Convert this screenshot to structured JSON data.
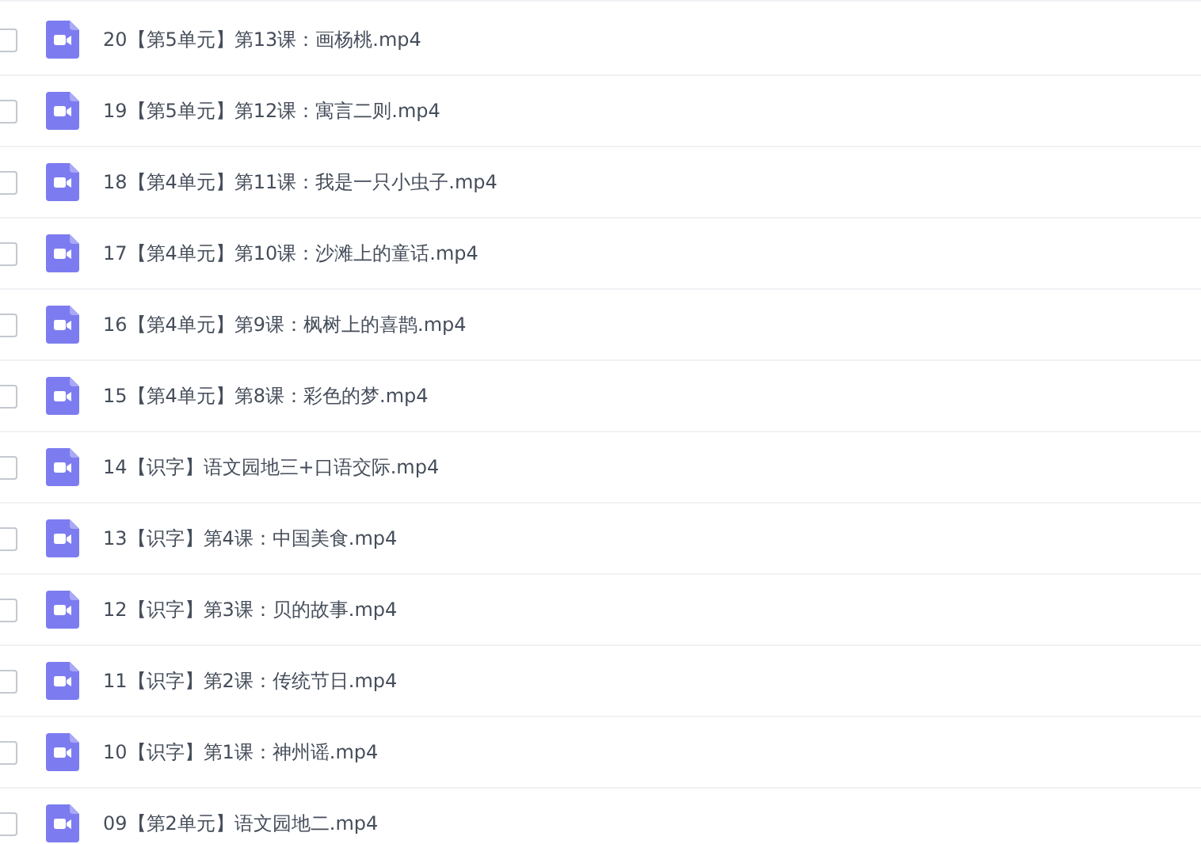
{
  "files": [
    {
      "name": "20【第5单元】第13课：画杨桃.mp4",
      "checked": false
    },
    {
      "name": "19【第5单元】第12课：寓言二则.mp4",
      "checked": false
    },
    {
      "name": "18【第4单元】第11课：我是一只小虫子.mp4",
      "checked": false
    },
    {
      "name": "17【第4单元】第10课：沙滩上的童话.mp4",
      "checked": false
    },
    {
      "name": "16【第4单元】第9课：枫树上的喜鹊.mp4",
      "checked": false
    },
    {
      "name": "15【第4单元】第8课：彩色的梦.mp4",
      "checked": false
    },
    {
      "name": "14【识字】语文园地三+口语交际.mp4",
      "checked": false
    },
    {
      "name": "13【识字】第4课：中国美食.mp4",
      "checked": false
    },
    {
      "name": "12【识字】第3课：贝的故事.mp4",
      "checked": false
    },
    {
      "name": "11【识字】第2课：传统节日.mp4",
      "checked": false
    },
    {
      "name": "10【识字】第1课：神州谣.mp4",
      "checked": false
    },
    {
      "name": "09【第2单元】语文园地二.mp4",
      "checked": false
    }
  ]
}
